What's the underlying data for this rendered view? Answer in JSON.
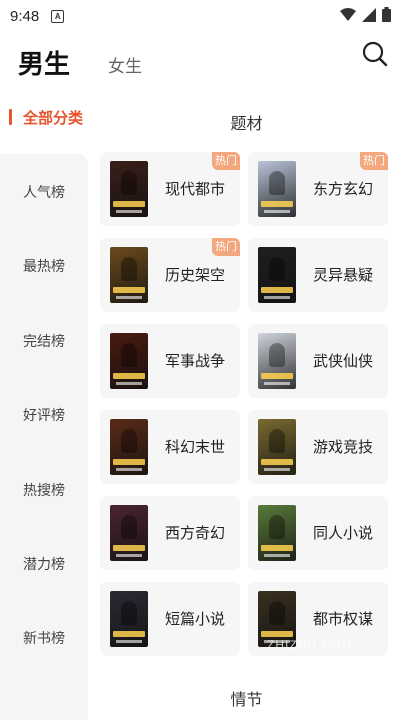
{
  "status_bar": {
    "time": "9:48",
    "notif_badge": "A"
  },
  "header": {
    "tab_male": "男生",
    "tab_female": "女生",
    "search_icon": "search-icon"
  },
  "sidebar": {
    "active": "全部分类",
    "items": [
      "人气榜",
      "最热榜",
      "完结榜",
      "好评榜",
      "热搜榜",
      "潜力榜",
      "新书榜"
    ]
  },
  "sections": {
    "theme_title": "题材",
    "plot_title": "情节"
  },
  "categories": [
    {
      "label": "现代都市",
      "badge": "热门",
      "cover_color": "#3a1f1a"
    },
    {
      "label": "东方玄幻",
      "badge": "热门",
      "cover_color": "#b8c4d6"
    },
    {
      "label": "历史架空",
      "badge": "热门",
      "cover_color": "#6b4a1c"
    },
    {
      "label": "灵异悬疑",
      "badge": "",
      "cover_color": "#1f1f22"
    },
    {
      "label": "军事战争",
      "badge": "",
      "cover_color": "#4a1a10"
    },
    {
      "label": "武侠仙侠",
      "badge": "",
      "cover_color": "#cfd4dc"
    },
    {
      "label": "科幻末世",
      "badge": "",
      "cover_color": "#5a2a18"
    },
    {
      "label": "游戏竞技",
      "badge": "",
      "cover_color": "#7a6a30"
    },
    {
      "label": "西方奇幻",
      "badge": "",
      "cover_color": "#4a2430"
    },
    {
      "label": "同人小说",
      "badge": "",
      "cover_color": "#5a7a3a"
    },
    {
      "label": "短篇小说",
      "badge": "",
      "cover_color": "#2a2a35"
    },
    {
      "label": "都市权谋",
      "badge": "",
      "cover_color": "#3a3020"
    }
  ],
  "watermark": "ZHIZHU.COM"
}
